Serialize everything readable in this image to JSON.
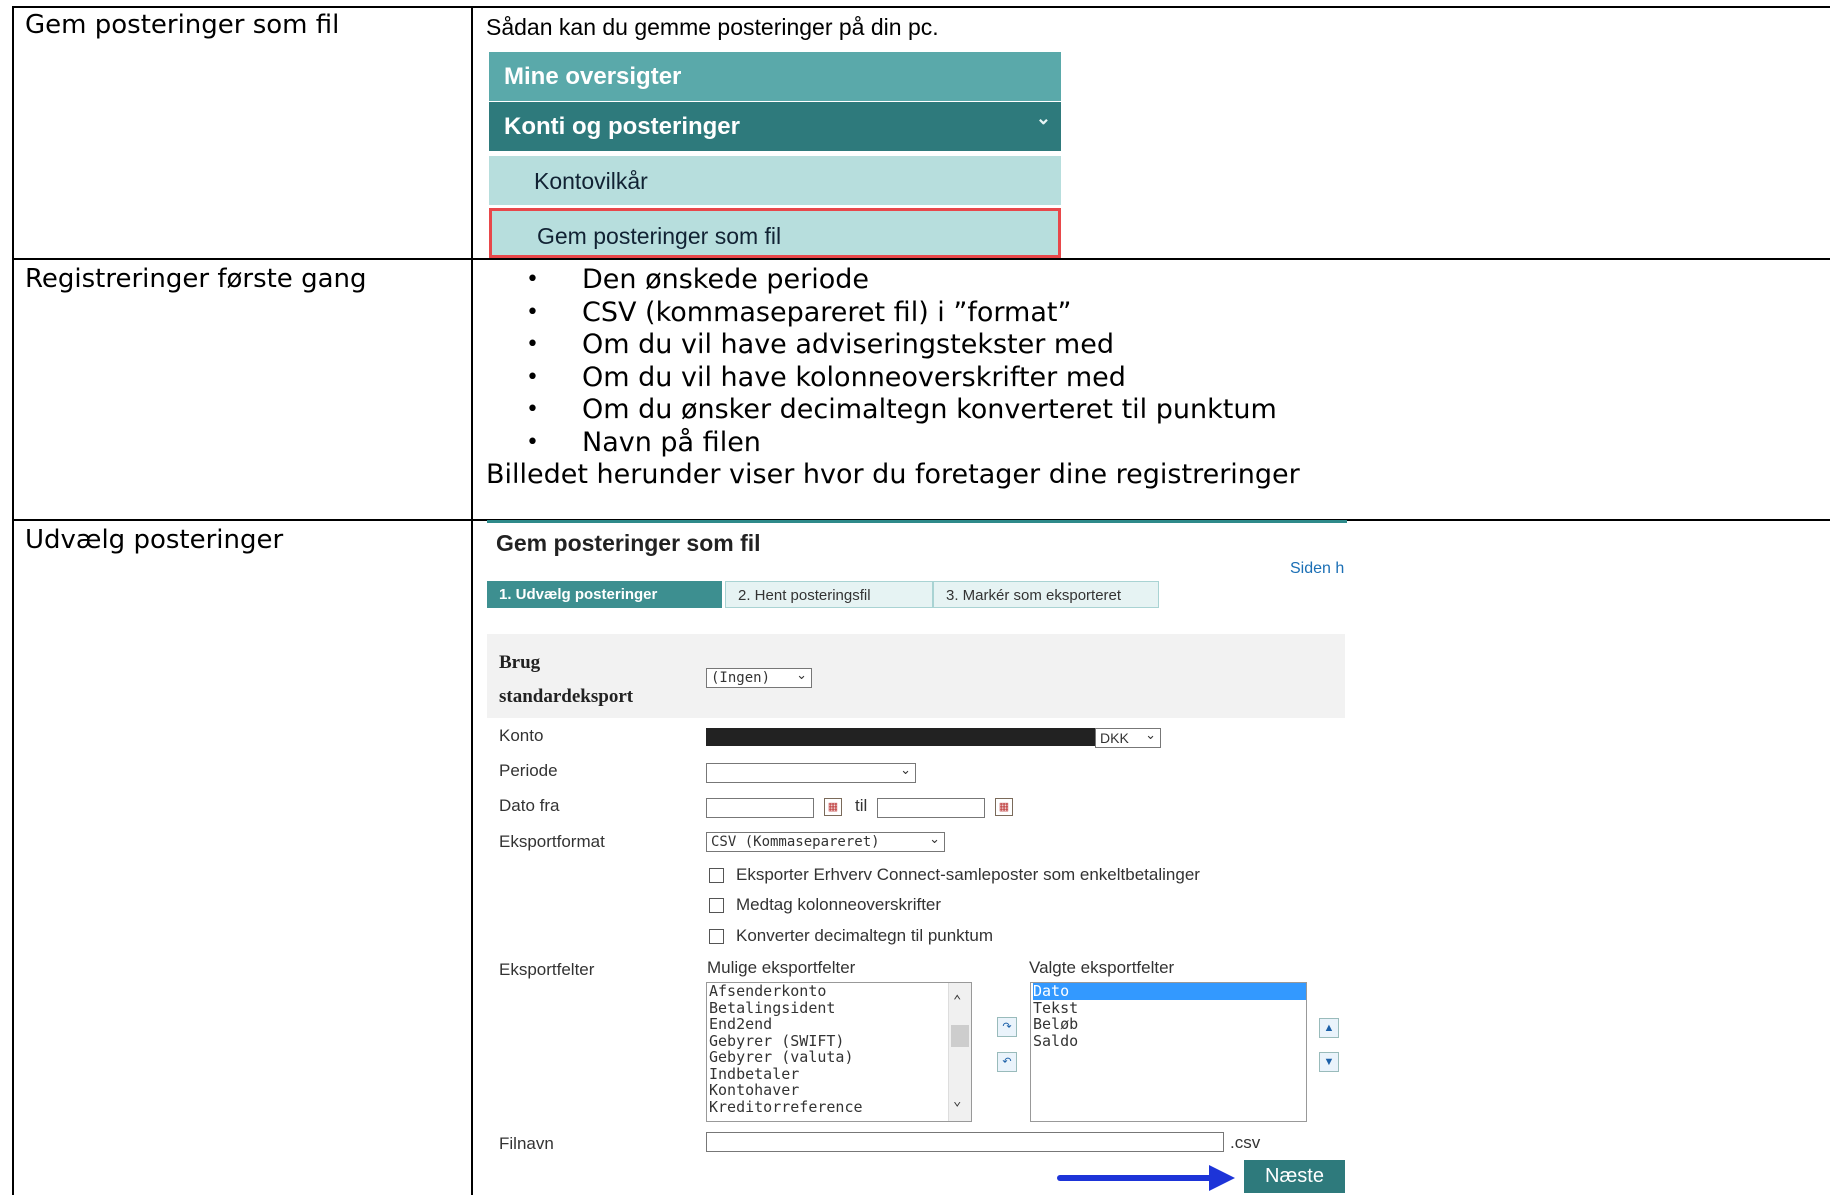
{
  "rows": [
    {
      "label": "Gem posteringer som fil"
    },
    {
      "label": "Registreringer første gang"
    },
    {
      "label": "Udvælg posteringer"
    }
  ],
  "row1": {
    "intro": "Sådan kan du gemme posteringer på din pc.",
    "menu": {
      "item1": "Mine oversigter",
      "item2": "Konti og posteringer",
      "item3": "Kontovilkår",
      "item4": "Gem posteringer som fil"
    }
  },
  "row2": {
    "bullets": [
      "Den ønskede periode",
      "CSV (kommasepareret fil) i ”format”",
      "Om du vil have adviseringstekster med",
      "Om du vil have kolonneoverskrifter med",
      "Om du ønsker decimaltegn konverteret til punktum",
      "Navn på filen"
    ],
    "caption": "Billedet herunder viser hvor du foretager dine  registreringer"
  },
  "form": {
    "title": "Gem posteringer som fil",
    "side_link": "Siden h",
    "steps": [
      "1. Udvælg posteringer",
      "2. Hent posteringsfil",
      "3. Markér som eksporteret"
    ],
    "std_label_1": "Brug",
    "std_label_2": "standardeksport",
    "std_value": "(Ingen)",
    "konto_label": "Konto",
    "konto_currency": "DKK",
    "periode_label": "Periode",
    "dato_label": "Dato fra",
    "til": "til",
    "format_label": "Eksportformat",
    "format_value": "CSV (Kommasepareret)",
    "checkboxes": [
      "Eksporter Erhverv Connect-samleposter som enkeltbetalinger",
      "Medtag kolonneoverskrifter",
      "Konverter decimaltegn til punktum"
    ],
    "fields_label": "Eksportfelter",
    "available_label": "Mulige eksportfelter",
    "selected_label": "Valgte eksportfelter",
    "available": [
      "Afsenderkonto",
      "Betalingsident",
      "End2end",
      "Gebyrer (SWIFT)",
      "Gebyrer (valuta)",
      "Indbetaler",
      "Kontohaver",
      "Kreditorreference"
    ],
    "selected": [
      "Dato",
      "Tekst",
      "Beløb",
      "Saldo"
    ],
    "filename_label": "Filnavn",
    "filename_ext": ".csv",
    "next_label": "Næste"
  }
}
